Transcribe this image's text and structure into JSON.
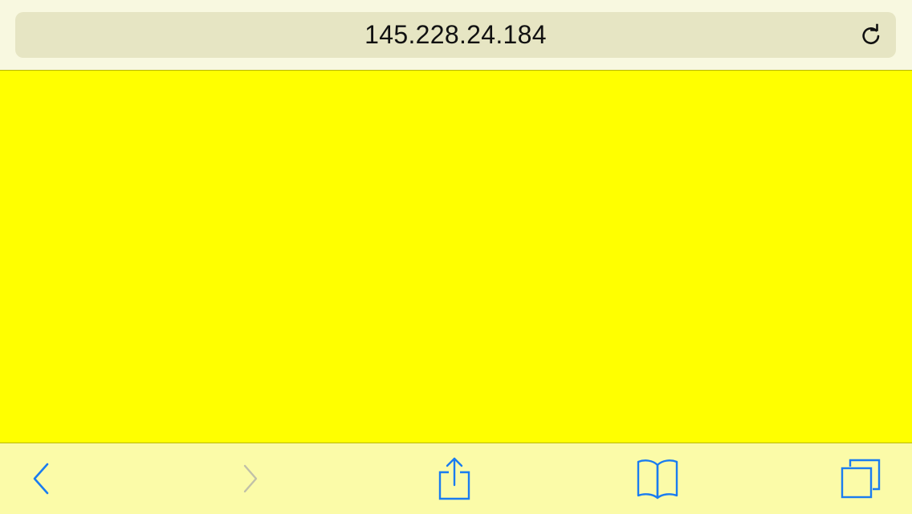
{
  "address_bar": {
    "url": "145.228.24.184",
    "reload_icon": "reload-icon"
  },
  "page": {
    "background_color": "#ffff00"
  },
  "toolbar": {
    "accent_color": "#1a7cf0",
    "disabled_color": "#c0c0a8",
    "back_icon": "chevron-left-icon",
    "forward_icon": "chevron-right-icon",
    "forward_enabled": false,
    "share_icon": "share-icon",
    "bookmarks_icon": "book-icon",
    "tabs_icon": "tabs-icon"
  }
}
